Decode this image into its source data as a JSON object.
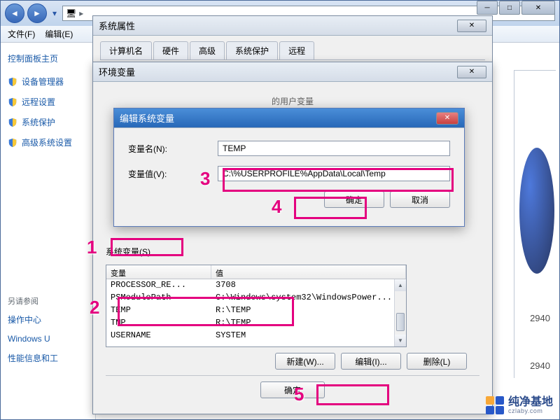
{
  "explorer": {
    "menu": {
      "file": "文件(F)",
      "edit": "编辑(E)"
    }
  },
  "sidebar": {
    "head": "控制面板主页",
    "items": [
      "设备管理器",
      "远程设置",
      "系统保护",
      "高级系统设置"
    ],
    "seealso": "另请参阅",
    "links": [
      "操作中心",
      "Windows U",
      "性能信息和工"
    ]
  },
  "right": {
    "num1": "2940",
    "num2": "2940"
  },
  "sysprops": {
    "title": "系统属性",
    "tabs": [
      "计算机名",
      "硬件",
      "高级",
      "系统保护",
      "远程"
    ]
  },
  "envvars": {
    "title": "环境变量",
    "userSectionRemnant": "的用户变量",
    "sysSection": "系统变量(S)",
    "cols": {
      "name": "变量",
      "value": "值"
    },
    "rows": [
      {
        "name": "PROCESSOR_RE...",
        "value": "3708"
      },
      {
        "name": "PSModulePath",
        "value": "C:\\Windows\\system32\\WindowsPower..."
      },
      {
        "name": "TEMP",
        "value": "R:\\TEMP"
      },
      {
        "name": "TMP",
        "value": "R:\\TEMP"
      },
      {
        "name": "USERNAME",
        "value": "SYSTEM"
      }
    ],
    "buttons": {
      "new": "新建(W)...",
      "edit": "编辑(I)...",
      "del": "删除(L)",
      "ok": "确定"
    }
  },
  "editvar": {
    "title": "编辑系统变量",
    "nameLabel": "变量名(N):",
    "valueLabel": "变量值(V):",
    "nameValue": "TEMP",
    "valueValue": "C:\\%USERPROFILE%AppData\\Local\\Temp",
    "ok": "确定",
    "cancel": "取消"
  },
  "annotations": {
    "n1": "1",
    "n2": "2",
    "n3": "3",
    "n4": "4",
    "n5": "5"
  },
  "watermark": {
    "main": "纯净基地",
    "sub": "czlaby.com"
  }
}
